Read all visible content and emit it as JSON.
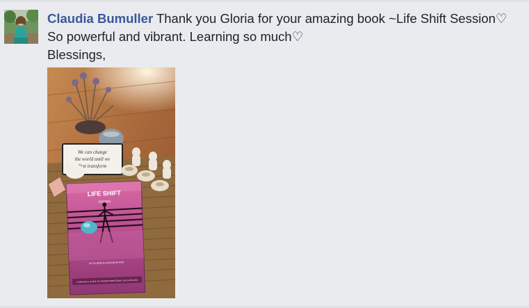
{
  "comment": {
    "author": "Claudia Bumuller",
    "line1": "Thank you Gloria for your amazing book ~Life Shift Session♡",
    "line2": "So powerful and vibrant. Learning so much♡",
    "line3": "Blessings,"
  },
  "photo": {
    "sign_text": [
      "We can change",
      "the world until we",
      "first transform"
    ],
    "book_title": "LIFE SHIFT",
    "book_subtitle": "SESSION",
    "book_author": "BY GLORIA PLASCENCIA PHD",
    "book_tagline": "A GRATEFUL GUIDE TO TRANSFORMATIONAL SELF-HEALING"
  }
}
